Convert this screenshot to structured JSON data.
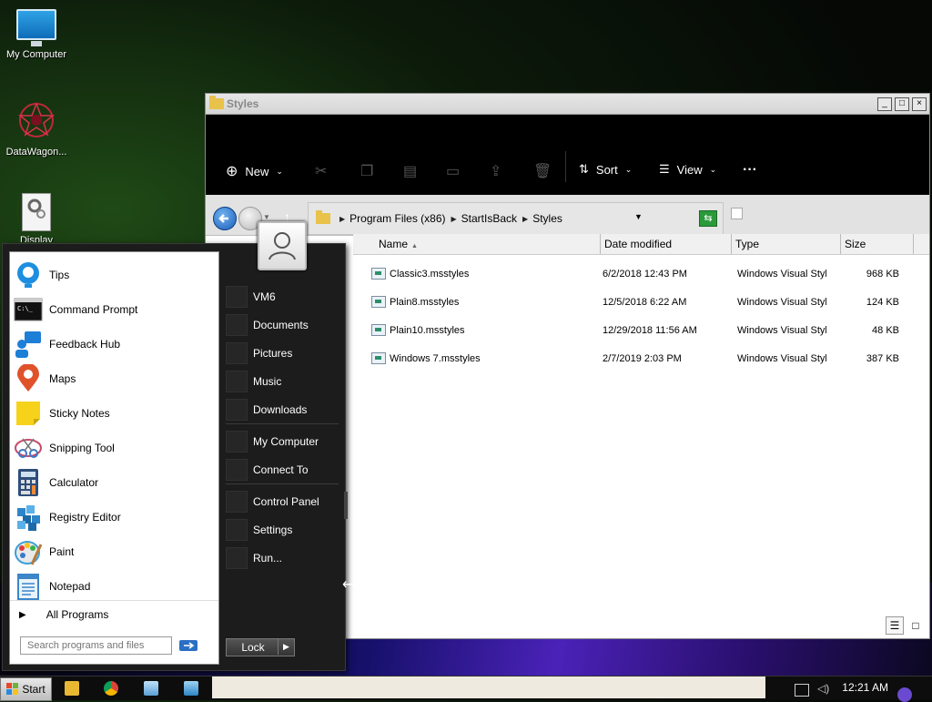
{
  "desktop": {
    "icons": [
      {
        "label": "My Computer",
        "icon": "monitor-icon"
      },
      {
        "label": "DataWagon...",
        "icon": "datawagon-icon"
      },
      {
        "label": "Display",
        "icon": "settings-page-icon"
      }
    ]
  },
  "explorer": {
    "title": "Styles",
    "toolbar": {
      "new_label": "New",
      "sort_label": "Sort",
      "view_label": "View",
      "more_label": "···"
    },
    "address": {
      "crumbs": [
        "Program Files (x86)",
        "StartIsBack",
        "Styles"
      ]
    },
    "columns": [
      "Name",
      "Date modified",
      "Type",
      "Size"
    ],
    "files": [
      {
        "name": "Classic3.msstyles",
        "date": "6/2/2018 12:43 PM",
        "type": "Windows Visual Styl...",
        "size": "968 KB"
      },
      {
        "name": "Plain8.msstyles",
        "date": "12/5/2018 6:22 AM",
        "type": "Windows Visual Styl...",
        "size": "124 KB"
      },
      {
        "name": "Plain10.msstyles",
        "date": "12/29/2018 11:56 AM",
        "type": "Windows Visual Styl...",
        "size": "48 KB"
      },
      {
        "name": "Windows 7.msstyles",
        "date": "2/7/2019 2:03 PM",
        "type": "Windows Visual Styl...",
        "size": "387 KB"
      }
    ]
  },
  "startmenu": {
    "programs": [
      {
        "label": "Tips",
        "icon": "tips-icon",
        "color": "#1e8fe0"
      },
      {
        "label": "Command Prompt",
        "icon": "command-prompt-icon",
        "color": "#111111"
      },
      {
        "label": "Feedback Hub",
        "icon": "feedback-hub-icon",
        "color": "#1e7fd6"
      },
      {
        "label": "Maps",
        "icon": "maps-icon",
        "color": "#e0522a"
      },
      {
        "label": "Sticky Notes",
        "icon": "sticky-notes-icon",
        "color": "#f7d21b"
      },
      {
        "label": "Snipping Tool",
        "icon": "snipping-tool-icon",
        "color": "#c94a6a"
      },
      {
        "label": "Calculator",
        "icon": "calculator-icon",
        "color": "#2e4d7a"
      },
      {
        "label": "Registry Editor",
        "icon": "registry-editor-icon",
        "color": "#2e86c8"
      },
      {
        "label": "Paint",
        "icon": "paint-icon",
        "color": "#3aa0d8"
      },
      {
        "label": "Notepad",
        "icon": "notepad-icon",
        "color": "#3c86c9"
      }
    ],
    "all_programs": "All Programs",
    "search_placeholder": "Search programs and files",
    "places_group1": [
      "VM6",
      "Documents",
      "Pictures",
      "Music",
      "Downloads"
    ],
    "places_group2": [
      "My Computer",
      "Connect To"
    ],
    "places_group3": [
      "Control Panel",
      "Settings",
      "Run..."
    ],
    "lock_label": "Lock"
  },
  "taskbar": {
    "start_label": "Start",
    "clock": "12:21 AM"
  }
}
